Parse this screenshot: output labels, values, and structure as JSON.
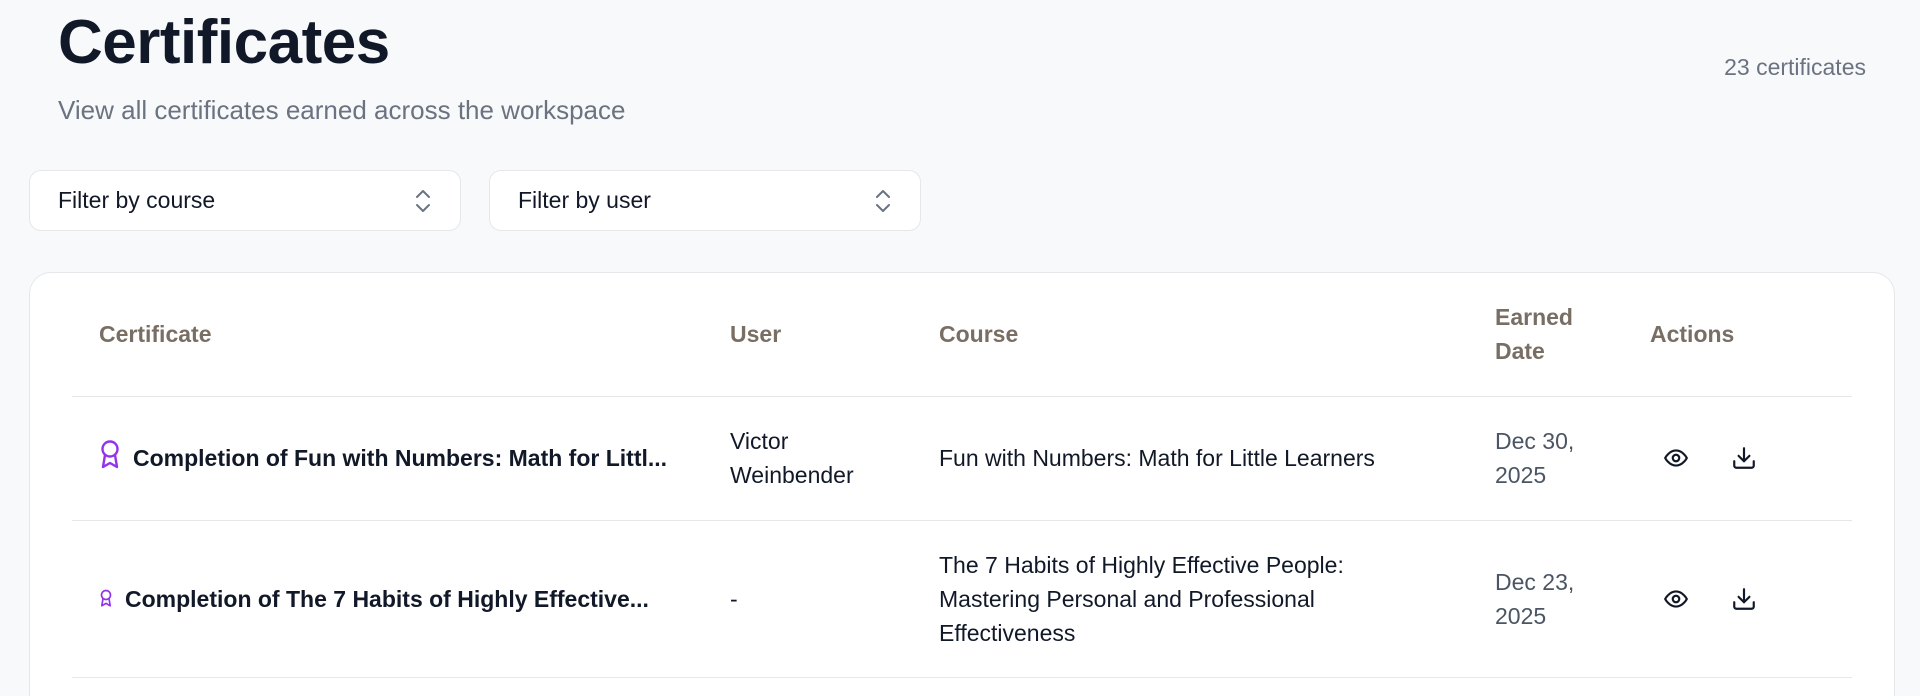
{
  "header": {
    "title": "Certificates",
    "subtitle": "View all certificates earned across the workspace",
    "count": "23 certificates"
  },
  "filters": {
    "course_label": "Filter by course",
    "user_label": "Filter by user"
  },
  "table": {
    "columns": {
      "certificate": "Certificate",
      "user": "User",
      "course": "Course",
      "earned_date_line1": "Earned",
      "earned_date_line2": "Date",
      "actions": "Actions"
    },
    "rows": [
      {
        "certificate": "Completion of Fun with Numbers: Math for Littl...",
        "user_line1": "Victor",
        "user_line2": "Weinbender",
        "course": "Fun with Numbers: Math for Little Learners",
        "date_line1": "Dec 30,",
        "date_line2": "2025"
      },
      {
        "certificate": "Completion of The 7 Habits of Highly Effective...",
        "user_line1": "-",
        "user_line2": "",
        "course_line1": "The 7 Habits of Highly Effective People:",
        "course_line2": "Mastering Personal and Professional",
        "course_line3": "Effectiveness",
        "date_line1": "Dec 23,",
        "date_line2": "2025"
      }
    ]
  },
  "icons": {
    "award": "award-icon",
    "view": "eye-icon",
    "download": "download-icon",
    "chevrons": "chevron-up-down-icon"
  },
  "colors": {
    "accent": "#9333ea",
    "header_text": "#786e63",
    "muted": "#6b7280"
  }
}
